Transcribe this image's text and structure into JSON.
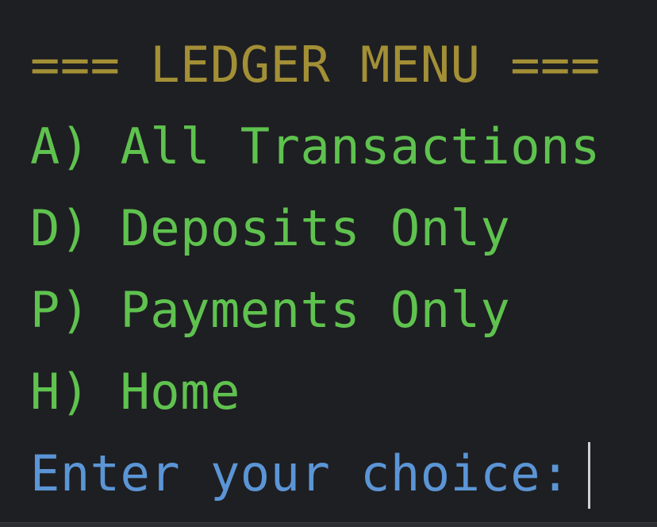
{
  "terminal": {
    "title": "=== LEDGER MENU ===",
    "options": [
      "A) All Transactions",
      "D) Deposits Only",
      "P) Payments Only",
      "H) Home"
    ],
    "prompt": "Enter your choice:"
  },
  "colors": {
    "background": "#1e1f22",
    "title": "#a38f36",
    "option": "#5fc24f",
    "prompt": "#5b95d6",
    "caret": "#cfd1d4"
  }
}
